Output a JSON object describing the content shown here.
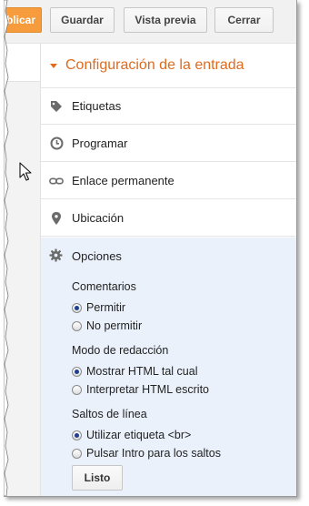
{
  "toolbar": {
    "publish_label": "ublicar",
    "save_label": "Guardar",
    "preview_label": "Vista previa",
    "close_label": "Cerrar",
    "publish_color": "#f69c3d"
  },
  "panel": {
    "title": "Configuración de la entrada",
    "title_color": "#dd6b20",
    "rows": [
      {
        "label": "Etiquetas",
        "icon": "tag-icon"
      },
      {
        "label": "Programar",
        "icon": "clock-icon"
      },
      {
        "label": "Enlace permanente",
        "icon": "link-icon"
      },
      {
        "label": "Ubicación",
        "icon": "location-pin-icon"
      }
    ],
    "options": {
      "label": "Opciones",
      "icon": "gear-icon",
      "background": "#eaf1fb",
      "comments": {
        "label": "Comentarios",
        "choices": [
          "Permitir",
          "No permitir"
        ],
        "selected": "Permitir"
      },
      "compose_mode": {
        "label": "Modo de redacción",
        "choices": [
          "Mostrar HTML tal cual",
          "Interpretar HTML escrito"
        ],
        "selected": "Mostrar HTML tal cual"
      },
      "line_breaks": {
        "label": "Saltos de línea",
        "choices": [
          "Utilizar etiqueta <br>",
          "Pulsar Intro para los saltos"
        ],
        "selected": "Utilizar etiqueta <br>"
      },
      "done_label": "Listo"
    }
  }
}
